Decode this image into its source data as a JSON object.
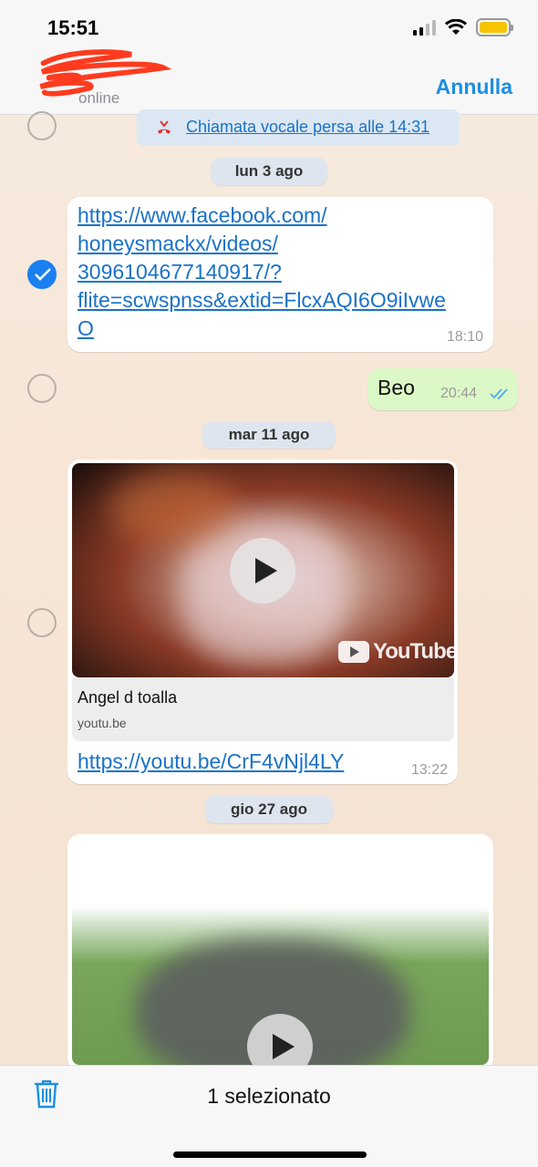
{
  "status_bar": {
    "time": "15:51"
  },
  "header": {
    "contact_status": "online",
    "cancel_label": "Annulla"
  },
  "messages": {
    "missed_call": "Chiamata vocale persa alle 14:31",
    "date1": "lun 3 ago",
    "link1_lines": [
      "https://www.facebook.com/",
      "honeysmackx/videos/",
      "3096104677140917/?",
      "flite=scwspnss&extid=FlcxAQI6O9iIvwe",
      "O"
    ],
    "link1_time": "18:10",
    "out_text": "Beo",
    "out_time": "20:44",
    "date2": "mar 11 ago",
    "video_title": "Angel d toalla",
    "video_domain": "youtu.be",
    "youtube_logo": "YouTube",
    "video_link": "https://youtu.be/CrF4vNjl4LY",
    "video_time": "13:22",
    "date3": "gio 27 ago"
  },
  "bottom_bar": {
    "selected_label": "1 selezionato"
  },
  "colors": {
    "accent": "#1a8fe3",
    "link": "#1a72c9",
    "outgoing_bubble": "#dcf8c6",
    "check": "#1a7ff0"
  }
}
